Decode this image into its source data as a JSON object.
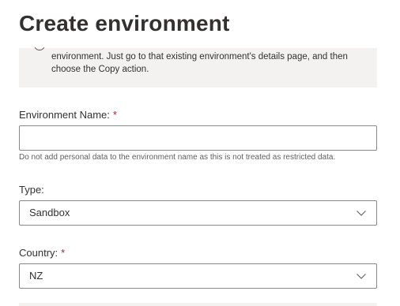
{
  "panel": {
    "title": "Create environment"
  },
  "info": {
    "text": "environment. Just go to that existing environment's details page, and then choose the Copy action.",
    "icon": "info-icon"
  },
  "environment_name": {
    "label": "Environment Name:",
    "required_marker": "*",
    "value": "",
    "placeholder": "",
    "helper": "Do not add personal data to the environment name as this is not treated as restricted data."
  },
  "type": {
    "label": "Type:",
    "selected": "Sandbox",
    "icon": "chevron-down-icon"
  },
  "country": {
    "label": "Country:",
    "required_marker": "*",
    "selected": "NZ",
    "icon": "chevron-down-icon"
  },
  "colors": {
    "required": "#a4262c",
    "info_background": "#f3f2f1",
    "border": "#8a8886"
  }
}
